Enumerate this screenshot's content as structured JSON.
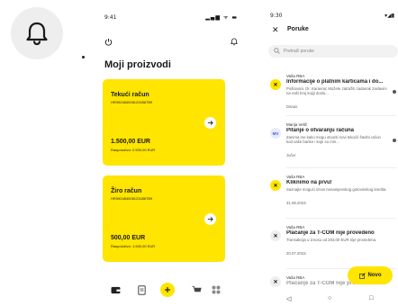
{
  "left": {
    "bell_icon": "bell-icon"
  },
  "middle": {
    "status_time": "9:41",
    "status_icons": "▂▄▆ ᯤ ▬",
    "title": "Moji proizvodi",
    "accounts": [
      {
        "name": "Tekući račun",
        "iban": "HR3924840081234567B9",
        "amount": "1.500,00 EUR",
        "available": "Raspoloživo: 2.500,00 EUR"
      },
      {
        "name": "Žiro račun",
        "iban": "HR3924840081234567B9",
        "amount": "500,00 EUR",
        "available": "Raspoloživo: 1.500,00 EUR"
      }
    ],
    "nav": [
      "wallet-icon",
      "document-icon",
      "plus-icon",
      "cart-icon",
      "grid-icon"
    ]
  },
  "right": {
    "status_time": "9:30",
    "status_icons": "▾◢▮",
    "title": "Poruke",
    "search_placeholder": "Pretraži poruke",
    "messages": [
      {
        "sender": "Vaša RBA",
        "subject": "Informacije o platnim karticama i do...",
        "preview": "Poštovani, Dr. Karavrac Možete zatražiti zadanak zaslavini na naši broj kojiji doslu...",
        "date": "Danas",
        "avatar": "✕",
        "unread": true
      },
      {
        "sender": "Marija Velič",
        "subject": "Pitanje o otvaranju računa",
        "preview": "Zanima me kako mogu otvoriti novi tekući/ štedni račun kod vaše banke i koje su min...",
        "date": "Jučer",
        "avatar": "MV",
        "unread": true
      },
      {
        "sender": "Vaša RBA",
        "subject": "Kliknimo na prvu!",
        "preview": "Saznajte mogući iznos nenamjenskog gotovinskog kredita.",
        "date": "31.08.2023.",
        "avatar": "✕",
        "unread": false
      },
      {
        "sender": "Vaša RBA",
        "subject": "Plaćanje za T-COM nije provedeno",
        "preview": "Transakcija u iznosu od 203,00 EUR nije provedena.",
        "date": "20.07.2023.",
        "avatar": "✕",
        "unread": false
      },
      {
        "sender": "Vaša RBA",
        "subject": "Plaćanje za T-COM nije provedeno",
        "preview": "",
        "date": "",
        "avatar": "✕",
        "unread": false
      }
    ],
    "new_button": "Novo",
    "system_nav": [
      "◁",
      "○",
      "□"
    ]
  }
}
